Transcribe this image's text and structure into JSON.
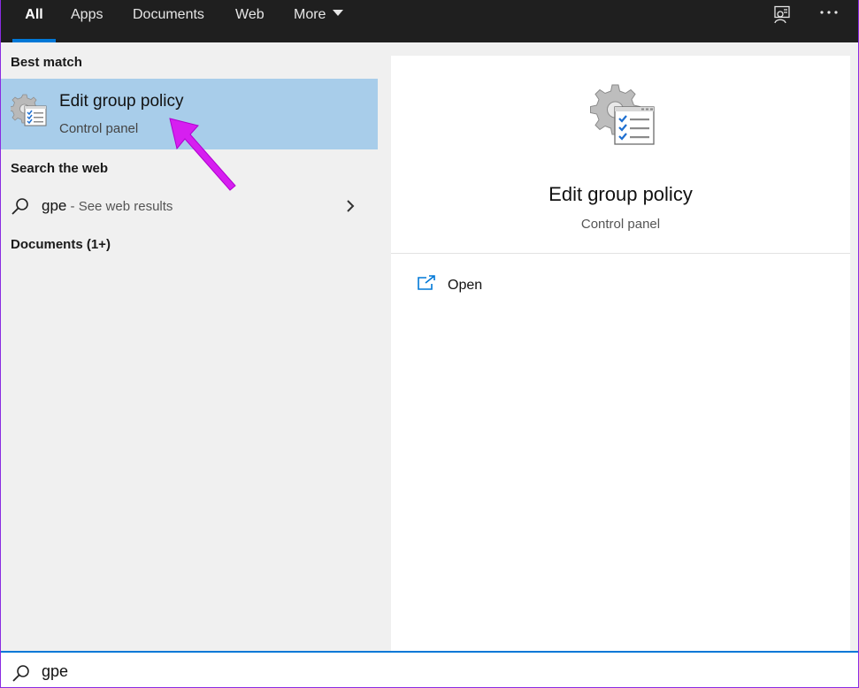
{
  "tabs": [
    {
      "label": "All",
      "active": true
    },
    {
      "label": "Apps"
    },
    {
      "label": "Documents"
    },
    {
      "label": "Web"
    },
    {
      "label": "More"
    }
  ],
  "top_icons": [
    "feedback-icon",
    "more-options-icon"
  ],
  "left": {
    "best_match_header": "Best match",
    "best_match": {
      "title": "Edit group policy",
      "subtitle": "Control panel",
      "icon": "group-policy-icon"
    },
    "search_web_header": "Search the web",
    "web_result": {
      "query": "gpe",
      "hint": " - See web results"
    },
    "documents_header": "Documents (1+)"
  },
  "preview": {
    "title": "Edit group policy",
    "subtitle": "Control panel",
    "actions": [
      {
        "label": "Open",
        "icon": "open-icon"
      }
    ]
  },
  "search": {
    "value": "gpe"
  },
  "colors": {
    "accent": "#0078d7",
    "selection": "#a8cdea",
    "annotation_arrow": "#d61ff0",
    "topbar": "#1f1f1f"
  }
}
